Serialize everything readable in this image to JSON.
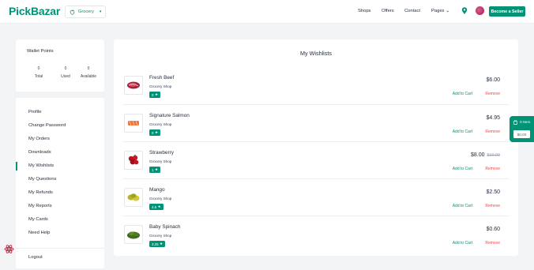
{
  "brand": {
    "part1": "Pick",
    "part2": "Bazar"
  },
  "type_select": {
    "icon": "apple-icon",
    "value": "Grocery"
  },
  "nav": {
    "shops": "Shops",
    "offers": "Offers",
    "contact": "Contact",
    "pages": "Pages"
  },
  "header_actions": {
    "seller_button": "Become a Seller"
  },
  "wallet": {
    "title": "Wallet Points",
    "stats": [
      {
        "value": "0",
        "label": "Total"
      },
      {
        "value": "0",
        "label": "Used"
      },
      {
        "value": "0",
        "label": "Available"
      }
    ]
  },
  "menu": {
    "items": [
      "Profile",
      "Change Password",
      "My Orders",
      "Downloads",
      "My Wishlists",
      "My Questions",
      "My Refunds",
      "My Reports",
      "My Cards",
      "Need Help"
    ],
    "active": "My Wishlists",
    "logout": "Logout"
  },
  "wishlist": {
    "title": "My Wishlists",
    "add_to_cart_label": "Add to Cart",
    "remove_label": "Remove",
    "items": [
      {
        "name": "Fresh Beef",
        "shop": "Grocery Shop",
        "rating": "0",
        "price": "$6.00",
        "old_price": ""
      },
      {
        "name": "Signature Salmon",
        "shop": "Grocery Shop",
        "rating": "0",
        "price": "$4.95",
        "old_price": ""
      },
      {
        "name": "Strawberry",
        "shop": "Grocery Shop",
        "rating": "1",
        "price": "$8.00",
        "old_price": "$10.00"
      },
      {
        "name": "Mango",
        "shop": "Grocery Shop",
        "rating": "4.5",
        "price": "$2.50",
        "old_price": ""
      },
      {
        "name": "Baby Spinach",
        "shop": "Grocery Shop",
        "rating": "3.25",
        "price": "$0.60",
        "old_price": ""
      }
    ]
  },
  "cart": {
    "items_label": "0 Item",
    "total": "$0.00"
  },
  "colors": {
    "accent": "#019376",
    "remove": "#ef4444"
  }
}
